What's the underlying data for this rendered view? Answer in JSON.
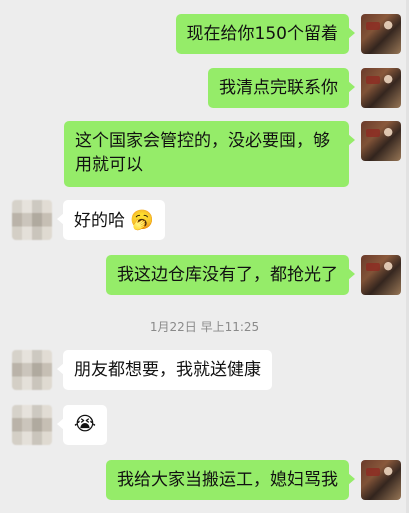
{
  "chat": {
    "messages": [
      {
        "from": "me",
        "text": "现在给你150个留着"
      },
      {
        "from": "me",
        "text": "我清点完联系你"
      },
      {
        "from": "me",
        "text": "这个国家会管控的，没必要囤，够用就可以"
      },
      {
        "from": "other",
        "text": "好的哈",
        "emoji": "🥱"
      },
      {
        "from": "me",
        "text": "我这边仓库没有了，都抢光了"
      },
      {
        "from": "timestamp",
        "text": "1月22日 早上11:25"
      },
      {
        "from": "other",
        "text": "朋友都想要，我就送健康"
      },
      {
        "from": "other",
        "text": "",
        "emoji": "😭"
      },
      {
        "from": "me",
        "text": "我给大家当搬运工，媳妇骂我"
      }
    ]
  },
  "colors": {
    "background": "#ededed",
    "my_bubble": "#95ec69",
    "other_bubble": "#ffffff"
  }
}
